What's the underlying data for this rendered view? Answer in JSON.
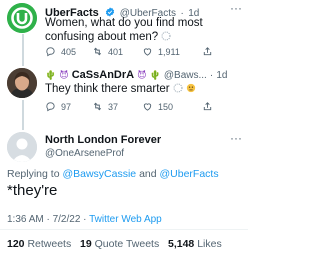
{
  "tweet1": {
    "display_name": "UberFacts",
    "handle": "@UberFacts",
    "separator": "·",
    "time": "1d",
    "text": "Women, what do you find most confusing about men?",
    "replies": "405",
    "retweets": "401",
    "likes": "1,911"
  },
  "tweet2": {
    "display_name": "CaSsAnDrA",
    "handle": "@Baws...",
    "separator": "·",
    "time": "1d",
    "text": "They think there smarter",
    "replies": "97",
    "retweets": "37",
    "likes": "150"
  },
  "main_tweet": {
    "display_name": "North London Forever",
    "handle": "@OneArseneProf",
    "replying_prefix": "Replying to",
    "replying_to_1": "@BawsyCassie",
    "replying_and": "and",
    "replying_to_2": "@UberFacts",
    "text": "*they're",
    "timestamp": "1:36 AM · 7/2/22 ·",
    "client": "Twitter Web App",
    "retweets_count": "120",
    "retweets_label": "Retweets",
    "quote_count": "19",
    "quote_label": "Quote Tweets",
    "likes_count": "5,148",
    "likes_label": "Likes"
  },
  "colors": {
    "brand": "#1d9bf0",
    "uberfacts_green": "#2fb14a",
    "text": "#0f1419",
    "muted": "#536471"
  }
}
